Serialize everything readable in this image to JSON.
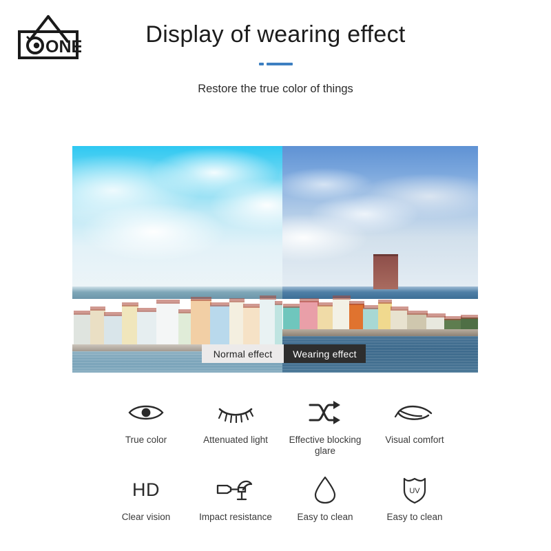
{
  "brand": {
    "logo_name": "one-hanging-sign-logo",
    "logo_text": "ONE"
  },
  "header": {
    "title": "Display of wearing effect",
    "subtitle": "Restore the true color of things",
    "divider_color": "#3d7fc1"
  },
  "comparison": {
    "name": "wearing-effect-comparison-photo",
    "scene_description": "Waterfront cityscape with colorful colonial row houses and harbor",
    "normal_label": "Normal effect",
    "wearing_label": "Wearing effect",
    "normal_label_bg": "#eceaea",
    "wearing_label_bg": "#2e2e2e"
  },
  "features": {
    "rows": [
      [
        {
          "icon": "eye-icon",
          "label": "True color"
        },
        {
          "icon": "eyelash-icon",
          "label": "Attenuated light"
        },
        {
          "icon": "shuffle-arrows-icon",
          "label": "Effective blocking glare"
        },
        {
          "icon": "leaf-eye-icon",
          "label": "Visual comfort"
        }
      ],
      [
        {
          "icon": "hd-text-icon",
          "label": "Clear vision",
          "text": "HD"
        },
        {
          "icon": "hammer-chisel-icon",
          "label": "Impact resistance"
        },
        {
          "icon": "water-drop-icon",
          "label": "Easy to clean"
        },
        {
          "icon": "uv-shield-icon",
          "label": "Easy to clean",
          "text": "UV"
        }
      ]
    ]
  }
}
